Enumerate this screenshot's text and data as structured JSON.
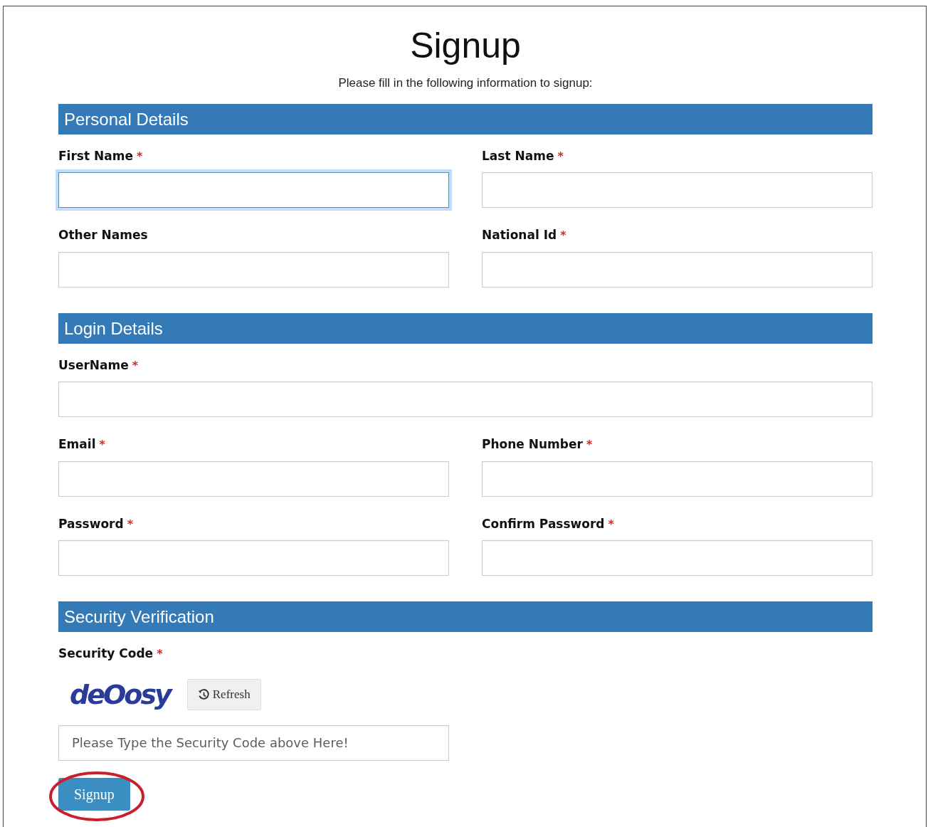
{
  "title": "Signup",
  "subtitle": "Please fill in the following information to signup:",
  "sections": [
    {
      "title": "Personal Details",
      "fields": [
        {
          "label": "First Name",
          "marker": "*",
          "kind": "half",
          "focused": true
        },
        {
          "label": "Last Name",
          "marker": "*",
          "kind": "half",
          "focused": false
        },
        {
          "label": "Other Names",
          "kind": "half",
          "focused": false
        },
        {
          "label": "National Id",
          "marker": "*",
          "kind": "half",
          "focused": false
        }
      ]
    },
    {
      "title": "Login Details",
      "fields": [
        {
          "label": "UserName",
          "marker": "*",
          "kind": "full",
          "focused": false
        },
        {
          "label": "Email",
          "marker": "*",
          "kind": "half",
          "focused": false
        },
        {
          "label": "Phone Number",
          "marker": "*",
          "kind": "half",
          "focused": false
        },
        {
          "label": "Password",
          "marker": "*",
          "kind": "half",
          "focused": false
        },
        {
          "label": "Confirm Password",
          "marker": "*",
          "kind": "half",
          "focused": false
        }
      ]
    }
  ],
  "security": {
    "title": "Security Verification",
    "label": "Security Code",
    "marker": "*",
    "captcha": "deOosy",
    "refresh_button": "Refresh",
    "code_field": {
      "placeholder": "Please Type the Security Code above Here!"
    }
  },
  "submit_button": "Signup"
}
